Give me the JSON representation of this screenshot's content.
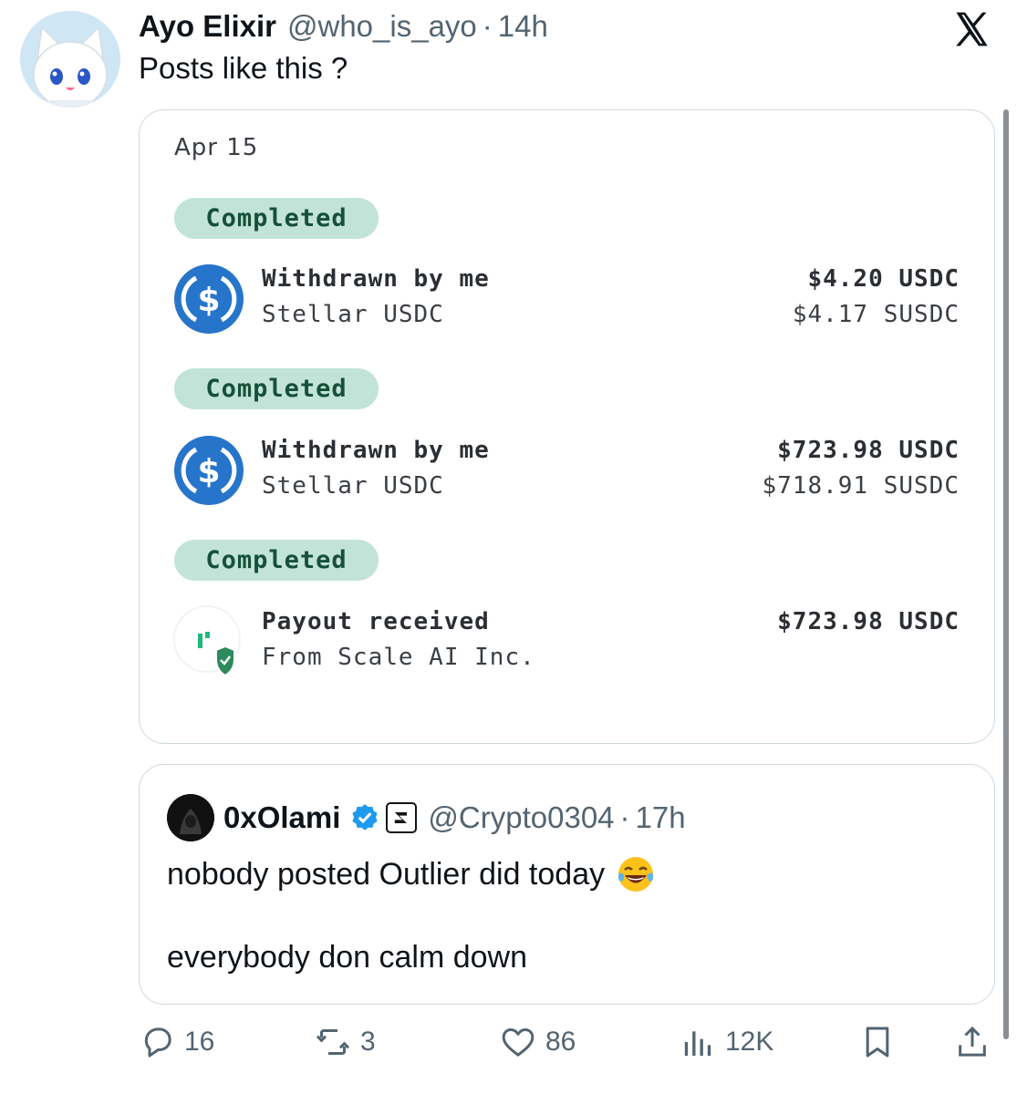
{
  "post": {
    "author_name": "Ayo Elixir",
    "author_handle": "@who_is_ayo",
    "separator": "·",
    "time": "14h",
    "text": "Posts like this ?"
  },
  "screenshot": {
    "date": "Apr 15",
    "transactions": [
      {
        "status": "Completed",
        "title": "Withdrawn by me",
        "subtitle": "Stellar USDC",
        "amount": "$4.20 USDC",
        "amount_secondary": "$4.17 SUSDC",
        "icon": "usdc-coin-icon"
      },
      {
        "status": "Completed",
        "title": "Withdrawn by me",
        "subtitle": "Stellar USDC",
        "amount": "$723.98 USDC",
        "amount_secondary": "$718.91 SUSDC",
        "icon": "usdc-coin-icon"
      },
      {
        "status": "Completed",
        "title": "Payout received",
        "subtitle": "From Scale AI Inc.",
        "amount": "$723.98 USDC",
        "amount_secondary": "",
        "icon": "scale-ai-logo-icon"
      }
    ]
  },
  "quote": {
    "author_name": "0xOlami",
    "author_handle": "@Crypto0304",
    "separator": "·",
    "time": "17h",
    "text_line1": "nobody posted Outlier did today",
    "text_line2": "everybody don calm down"
  },
  "actions": {
    "replies": "16",
    "reposts": "3",
    "likes": "86",
    "views": "12K"
  },
  "colors": {
    "badge_bg": "#c2e4d8",
    "badge_text": "#17503a",
    "usdc_blue": "#2775ca",
    "verified_blue": "#1d9bf0",
    "muted": "#536471"
  }
}
